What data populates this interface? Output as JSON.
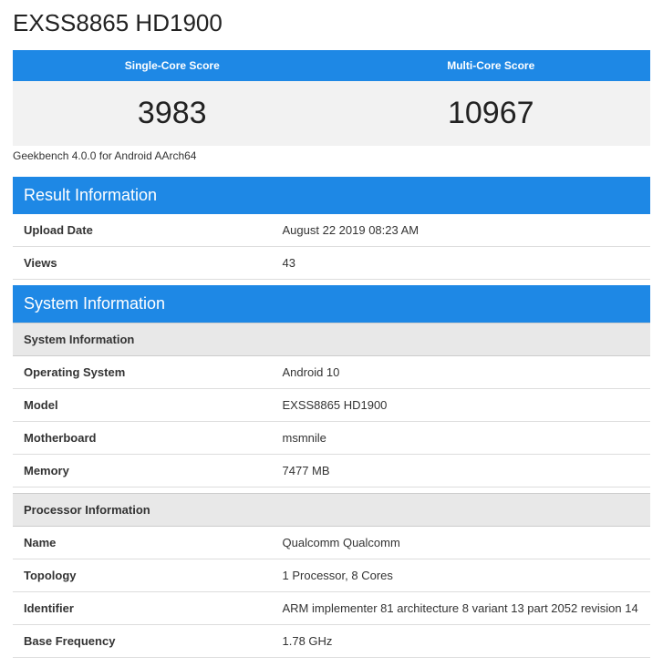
{
  "title": "EXSS8865 HD1900",
  "scores": {
    "single_label": "Single-Core Score",
    "single_value": "3983",
    "multi_label": "Multi-Core Score",
    "multi_value": "10967"
  },
  "version": "Geekbench 4.0.0 for Android AArch64",
  "result_section": {
    "header": "Result Information",
    "rows": [
      {
        "label": "Upload Date",
        "value": "August 22 2019 08:23 AM"
      },
      {
        "label": "Views",
        "value": "43"
      }
    ]
  },
  "system_section": {
    "header": "System Information",
    "sub1": "System Information",
    "rows1": [
      {
        "label": "Operating System",
        "value": "Android 10"
      },
      {
        "label": "Model",
        "value": "EXSS8865 HD1900"
      },
      {
        "label": "Motherboard",
        "value": "msmnile"
      },
      {
        "label": "Memory",
        "value": "7477 MB"
      }
    ],
    "sub2": "Processor Information",
    "rows2": [
      {
        "label": "Name",
        "value": "Qualcomm Qualcomm"
      },
      {
        "label": "Topology",
        "value": "1 Processor, 8 Cores"
      },
      {
        "label": "Identifier",
        "value": "ARM implementer 81 architecture 8 variant 13 part 2052 revision 14"
      },
      {
        "label": "Base Frequency",
        "value": "1.78 GHz"
      }
    ]
  }
}
